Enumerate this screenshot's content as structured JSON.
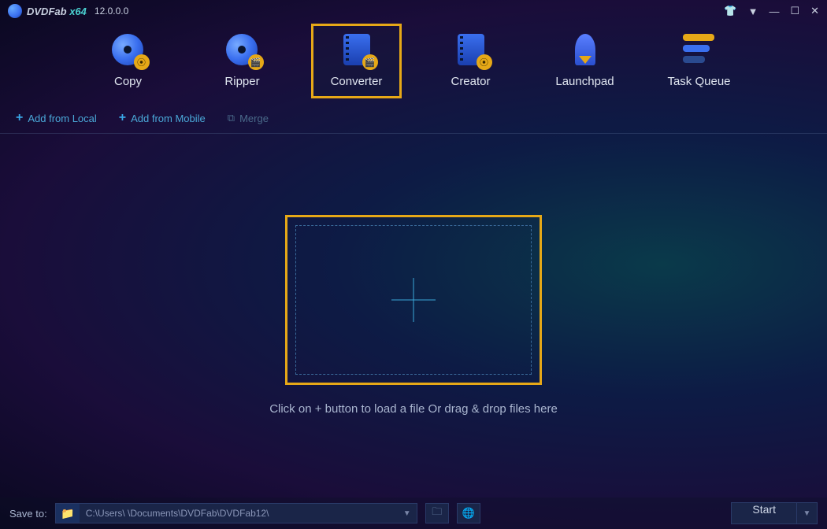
{
  "titlebar": {
    "app_name": "DVDFab",
    "arch": "x64",
    "version": "12.0.0.0"
  },
  "toolbar": {
    "items": [
      {
        "label": "Copy"
      },
      {
        "label": "Ripper"
      },
      {
        "label": "Converter"
      },
      {
        "label": "Creator"
      },
      {
        "label": "Launchpad"
      },
      {
        "label": "Task Queue"
      }
    ]
  },
  "subbar": {
    "add_local": "Add from Local",
    "add_mobile": "Add from Mobile",
    "merge": "Merge"
  },
  "main": {
    "hint": "Click on + button to load a file Or drag & drop files here"
  },
  "bottombar": {
    "save_to": "Save to:",
    "path": "C:\\Users\\                          \\Documents\\DVDFab\\DVDFab12\\",
    "start": "Start"
  }
}
